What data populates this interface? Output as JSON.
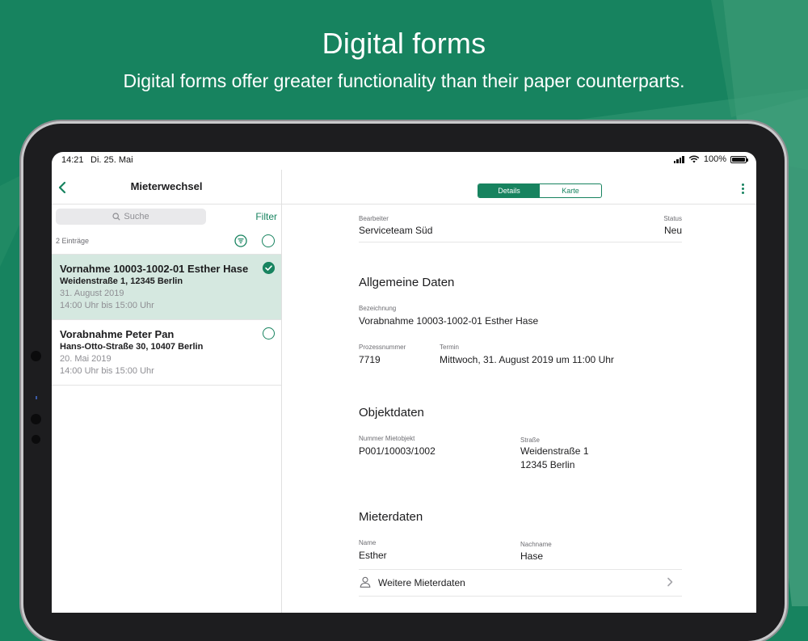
{
  "hero": {
    "title": "Digital forms",
    "subtitle": "Digital forms offer greater functionality than their paper counterparts."
  },
  "colors": {
    "brand": "#17835f",
    "selected_row": "#d5e8e0"
  },
  "statusbar": {
    "time": "14:21",
    "date": "Di. 25. Mai",
    "battery": "100%"
  },
  "left": {
    "title": "Mieterwechsel",
    "search_placeholder": "Suche",
    "filter_label": "Filter",
    "count": "2 Einträge",
    "items": [
      {
        "title": "Vornahme 10003-1002-01 Esther Hase",
        "address": "Weidenstraße 1, 12345 Berlin",
        "date": "31. August 2019",
        "time": "14:00 Uhr bis 15:00 Uhr",
        "checked": true
      },
      {
        "title": "Vorabnahme Peter Pan",
        "address": "Hans-Otto-Straße 30, 10407 Berlin",
        "date": "20. Mai 2019",
        "time": "14:00 Uhr bis 15:00 Uhr",
        "checked": false
      }
    ]
  },
  "right": {
    "tabs": [
      "Details",
      "Karte"
    ],
    "active_tab": "Details",
    "bearbeiter_label": "Bearbeiter",
    "bearbeiter_value": "Serviceteam Süd",
    "status_label": "Status",
    "status_value": "Neu",
    "allgemeine": {
      "title": "Allgemeine Daten",
      "bezeichnung_label": "Bezeichnung",
      "bezeichnung_value": "Vorabnahme 10003-1002-01 Esther Hase",
      "prozess_label": "Prozessnummer",
      "prozess_value": "7719",
      "termin_label": "Termin",
      "termin_value": "Mittwoch, 31. August 2019 um 11:00 Uhr"
    },
    "objekt": {
      "title": "Objektdaten",
      "nummer_label": "Nummer Mietobjekt",
      "nummer_value": "P001/10003/1002",
      "strasse_label": "Straße",
      "strasse_line1": "Weidenstraße 1",
      "strasse_line2": "12345 Berlin"
    },
    "mieter": {
      "title": "Mieterdaten",
      "name_label": "Name",
      "name_value": "Esther",
      "nachname_label": "Nachname",
      "nachname_value": "Hase",
      "more_label": "Weitere Mieterdaten"
    }
  }
}
